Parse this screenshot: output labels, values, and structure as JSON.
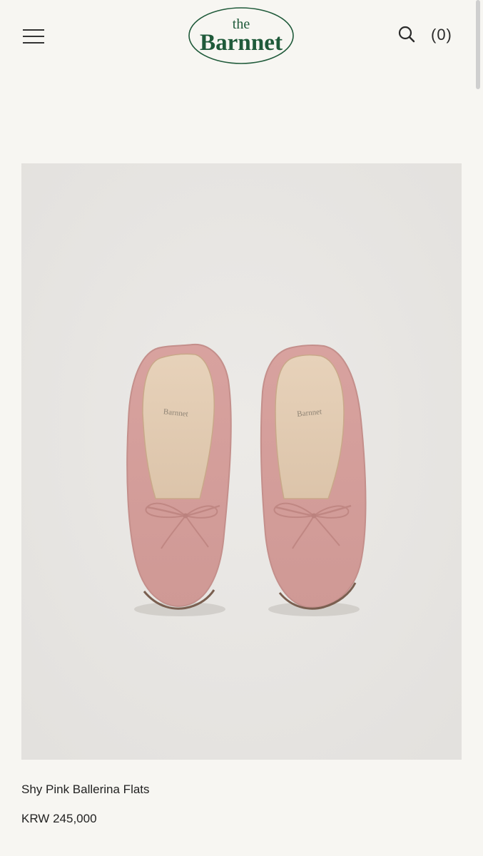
{
  "header": {
    "logo_small": "the",
    "logo_main": "Barnnet",
    "cart_label": "(0)",
    "menu_icon": "hamburger-icon",
    "search_icon": "search-icon"
  },
  "product": {
    "name": "Shy Pink Ballerina Flats",
    "price": "KRW 245,000",
    "insole_brand": "Barnnet"
  },
  "colors": {
    "background": "#f7f6f2",
    "brand_green": "#1f5a3a",
    "image_background": "#e9e7e4",
    "shoe_pink": "#d9a3a0"
  }
}
